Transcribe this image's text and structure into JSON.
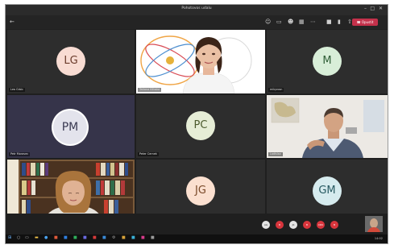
{
  "window": {
    "title": "Pohotovos udalu"
  },
  "toolbar": {
    "leave_label": "Opustit"
  },
  "participants": [
    {
      "initials": "LG",
      "name": "Lea Grbic",
      "avatar_bg": "#f8dcd3",
      "avatar_fg": "#6a3b2b"
    },
    {
      "initials": "",
      "name": "Tatiana Klibska"
    },
    {
      "initials": "M",
      "name": "mikyrosn",
      "avatar_bg": "#d8eed8",
      "avatar_fg": "#2f5e36"
    },
    {
      "initials": "PM",
      "name": "Petr Moravec",
      "avatar_bg": "#e3e3ec",
      "avatar_fg": "#3a3a52"
    },
    {
      "initials": "PC",
      "name": "Peter Cernek",
      "avatar_bg": "#e6edd6",
      "avatar_fg": "#4c5b2e"
    },
    {
      "initials": "",
      "name": "Ladislav"
    },
    {
      "initials": "",
      "name": "Iris Ondrasova"
    },
    {
      "initials": "JG",
      "name": "Jan Grbic",
      "avatar_bg": "#fbe0d0",
      "avatar_fg": "#7a4a2a"
    },
    {
      "initials": "GM",
      "name": "Gusztav Mischke",
      "avatar_bg": "#d6ebee",
      "avatar_fg": "#285a62"
    }
  ],
  "overflow_participants": [
    {
      "initials": "AG",
      "color": "#e4e4e4",
      "fg": "#333333"
    },
    {
      "initials": "B",
      "color": "#d8353c",
      "fg": "#ffffff"
    },
    {
      "initials": "JK",
      "color": "#e4e4e4",
      "fg": "#333333"
    },
    {
      "initials": "B",
      "color": "#d8353c",
      "fg": "#ffffff"
    },
    {
      "initials": "CDK",
      "color": "#d8353c",
      "fg": "#ffffff"
    },
    {
      "initials": "B",
      "color": "#d8353c",
      "fg": "#ffffff"
    }
  ],
  "taskbar": {
    "clock": "14:02"
  }
}
